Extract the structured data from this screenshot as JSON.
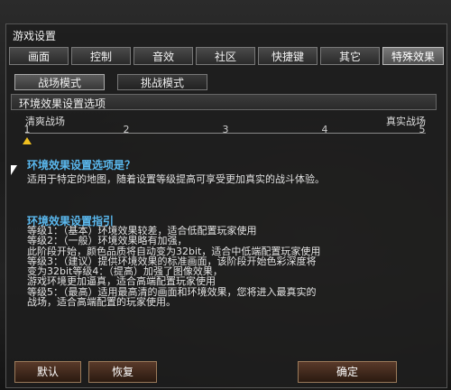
{
  "window": {
    "title": "游戏设置"
  },
  "tabs": [
    {
      "label": "画面"
    },
    {
      "label": "控制"
    },
    {
      "label": "音效"
    },
    {
      "label": "社区"
    },
    {
      "label": "快捷键"
    },
    {
      "label": "其它"
    },
    {
      "label": "特殊效果"
    }
  ],
  "active_tab": "特殊效果",
  "subtabs": [
    {
      "label": "战场模式"
    },
    {
      "label": "挑战模式"
    }
  ],
  "section": {
    "title": "环境效果设置选项"
  },
  "slider": {
    "left_label": "清爽战场",
    "right_label": "真实战场",
    "ticks": [
      "1",
      "2",
      "3",
      "4",
      "5"
    ],
    "value": 1,
    "handle_color": "#f0c020"
  },
  "description": {
    "title": "环境效果设置选项是？",
    "text": "适用于特定的地图，随着设置等级提高可享受更加真实的战斗体验。"
  },
  "guide": {
    "title": "环境效果设置指引",
    "lines": [
      "等级1：（基本）环境效果较差，适合低配置玩家使用",
      "等级2：（一般）环境效果略有加强，",
      "此阶段开始，颜色品质将自动变为32bit，适合中低端配置玩家使用",
      "等级3：（建议）提供环境效果的标准画面，该阶段开始色彩深度将",
      "变为32bit等级4：（提高）加强了图像效果，",
      "游戏环境更加逼真，适合高端配置玩家使用",
      "等级5：（最高）适用最高清的画面和环境效果，您将进入最真实的",
      "战场，适合高端配置的玩家使用。"
    ]
  },
  "buttons": {
    "default": "默认",
    "restore": "恢复",
    "confirm": "确定"
  },
  "colors": {
    "accent_blue": "#5ab8ee",
    "panel_bg": "#1e1e1e"
  }
}
